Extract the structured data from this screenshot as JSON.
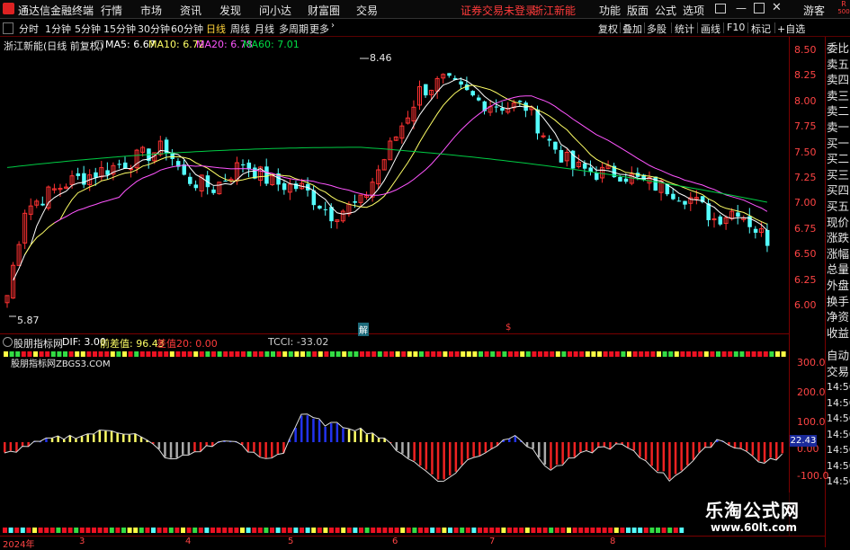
{
  "menubar": {
    "title": "通达信金融终端",
    "items": [
      "行情",
      "市场",
      "资讯",
      "发现",
      "问小达",
      "财富圈",
      "交易"
    ],
    "notice": "证券交易未登录",
    "stock_name": "浙江新能",
    "right_items": [
      "功能",
      "版面",
      "公式",
      "选项"
    ],
    "guest": "游客",
    "rlabel_top": "R",
    "rlabel_bottom": "500"
  },
  "toolbar": {
    "periods": [
      "分时",
      "1分钟",
      "5分钟",
      "15分钟",
      "30分钟",
      "60分钟",
      "日线",
      "周线",
      "月线",
      "多周期",
      "更多"
    ],
    "active_period": "日线",
    "right_items": [
      "复权",
      "叠加",
      "多股",
      "统计",
      "画线",
      "F10",
      "标记",
      "+自选"
    ]
  },
  "main_chart": {
    "header": {
      "name": "浙江新能(日线 前复权)",
      "ma5": "MA5: 6.67",
      "ma10": "MA10: 6.72",
      "ma20": "MA20: 6.78",
      "ma60": "MA60: 7.01"
    },
    "high_label": "8.46",
    "low_label": "5.87",
    "marker_jie": "解",
    "marker_s": "$",
    "y_ticks": [
      "8.50",
      "8.25",
      "8.00",
      "7.75",
      "7.50",
      "7.25",
      "7.00",
      "6.75",
      "6.50",
      "6.25",
      "6.00"
    ]
  },
  "sub_chart": {
    "header": {
      "indicator": "股朋指标网",
      "dif": "DIF: 3.00",
      "front": "前差值: 96.43",
      "diff": "差值20: 0.00",
      "tcci": "TCCI: -33.02"
    },
    "subtitle": "股朋指标网ZBGS3.COM",
    "y_ticks": [
      "300.0",
      "200.0",
      "100.0",
      "0.00",
      "-100.0"
    ],
    "current_value": "22.43"
  },
  "x_labels": [
    "2024年",
    "3",
    "4",
    "5",
    "6",
    "7",
    "8"
  ],
  "right_panel": {
    "items": [
      "委比",
      "卖五",
      "卖四",
      "卖三",
      "卖二",
      "卖一",
      "买一",
      "买二",
      "买三",
      "买四",
      "买五",
      "现价",
      "涨跌",
      "涨幅",
      "总量",
      "外盘",
      "换手",
      "净资",
      "收益",
      "自动",
      "交易"
    ],
    "times": [
      "14:56",
      "14:56",
      "14:56",
      "14:56",
      "14:56",
      "14:56",
      "14:56"
    ]
  },
  "watermark": {
    "brand": "乐淘公式网",
    "url": "www.60lt.com"
  },
  "colors": {
    "up": "#ff3232",
    "down": "#54ffff",
    "ma5": "#ffffff",
    "ma10": "#ffff66",
    "ma20": "#ff55ff",
    "ma60": "#00cc44"
  }
}
